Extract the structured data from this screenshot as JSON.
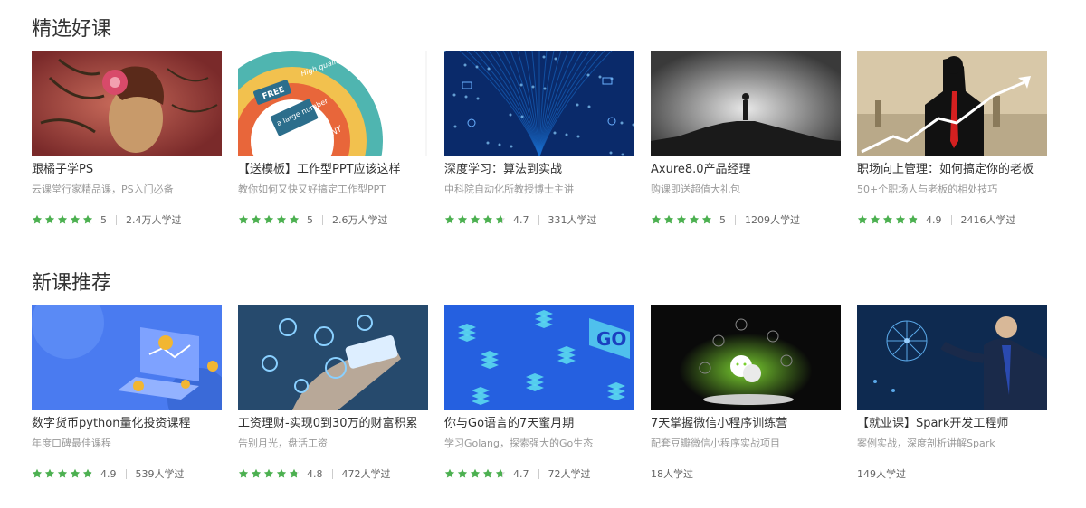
{
  "sections": [
    {
      "title": "精选好课",
      "courses": [
        {
          "title": "跟橘子学PS",
          "desc": "云课堂行家精品课，PS入门必备",
          "rating": 5,
          "rating_text": "5",
          "learners": "2.4万人学过",
          "thumb": "portrait-art",
          "colors": [
            "#7a2a2a",
            "#c89a6a"
          ]
        },
        {
          "title": "【送模板】工作型PPT应该这样",
          "desc": "教你如何又快又好搞定工作型PPT",
          "rating": 5,
          "rating_text": "5",
          "learners": "2.6万人学过",
          "thumb": "ppt-rings",
          "colors": [
            "#e8663a",
            "#f2c14e",
            "#4fb5b0",
            "#2c6e8c"
          ],
          "thumb_text": [
            "FREE",
            "High quality",
            "a large number",
            "FUNNY"
          ]
        },
        {
          "title": "深度学习：算法到实战",
          "desc": "中科院自动化所教授博士主讲",
          "rating": 4.7,
          "rating_text": "4.7",
          "learners": "331人学过",
          "thumb": "deep-learning",
          "colors": [
            "#0a2a6a",
            "#1a6fd0"
          ]
        },
        {
          "title": "Axure8.0产品经理",
          "desc": "购课即送超值大礼包",
          "rating": 5,
          "rating_text": "5",
          "learners": "1209人学过",
          "thumb": "mountain-man",
          "colors": [
            "#1a1a1a",
            "#e8e8e8"
          ]
        },
        {
          "title": "职场向上管理：如何搞定你的老板",
          "desc": "50+个职场人与老板的相处技巧",
          "rating": 4.9,
          "rating_text": "4.9",
          "learners": "2416人学过",
          "thumb": "business-chart",
          "colors": [
            "#d8c8a8",
            "#111111",
            "#d42020"
          ]
        }
      ]
    },
    {
      "title": "新课推荐",
      "courses": [
        {
          "title": "数字货币python量化投资课程",
          "desc": "年度口碑最佳课程",
          "rating": 4.9,
          "rating_text": "4.9",
          "learners": "539人学过",
          "thumb": "crypto-laptop",
          "colors": [
            "#4a7bf0",
            "#f2b632"
          ]
        },
        {
          "title": "工资理财-实现0到30万的财富积累",
          "desc": "告别月光，盘活工资",
          "rating": 4.8,
          "rating_text": "4.8",
          "learners": "472人学过",
          "thumb": "finance-phone",
          "colors": [
            "#1a2e4a",
            "#4aa0d8"
          ]
        },
        {
          "title": "你与Go语言的7天蜜月期",
          "desc": "学习Golang，探索强大的Go生态",
          "rating": 4.7,
          "rating_text": "4.7",
          "learners": "72人学过",
          "thumb": "go-iso",
          "colors": [
            "#2560e0",
            "#5ad8f0"
          ],
          "thumb_text": [
            "GO"
          ]
        },
        {
          "title": "7天掌握微信小程序训练营",
          "desc": "配套豆瓣微信小程序实战项目",
          "rating": null,
          "rating_text": "",
          "learners": "18人学过",
          "thumb": "wechat-hand",
          "colors": [
            "#0a0a0a",
            "#7ad030"
          ]
        },
        {
          "title": "【就业课】Spark开发工程师",
          "desc": "案例实战，深度剖析讲解Spark",
          "rating": null,
          "rating_text": "",
          "learners": "149人学过",
          "thumb": "spark-business",
          "colors": [
            "#0e2a50",
            "#5aa8e8"
          ]
        }
      ]
    }
  ],
  "colors": {
    "star": "#4cb050",
    "star_empty": "#d8d8d8",
    "title": "#333333",
    "desc": "#999999",
    "meta": "#666666"
  }
}
